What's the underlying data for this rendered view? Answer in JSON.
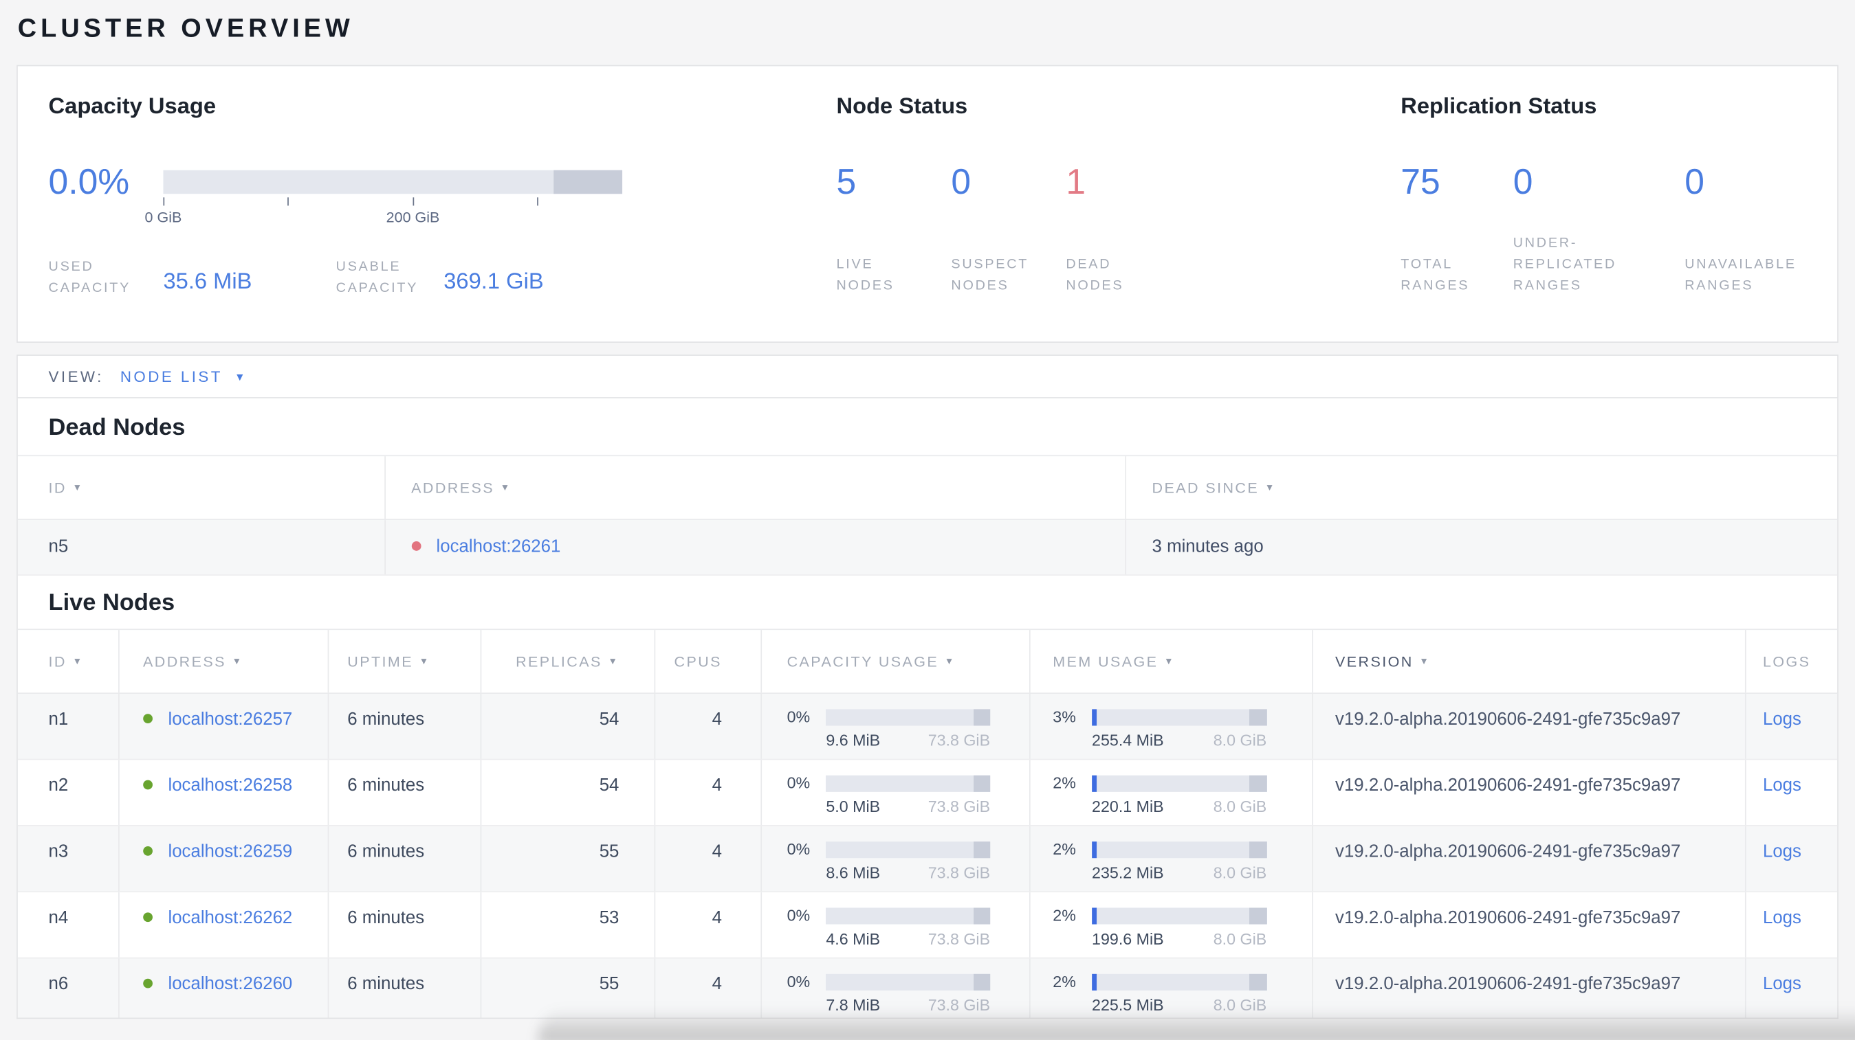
{
  "colors": {
    "accent_blue": "#4a7de0",
    "danger_red": "#e27a85",
    "live_dot": "#68a42f",
    "dead_dot": "#e2737f"
  },
  "page": {
    "title": "CLUSTER OVERVIEW"
  },
  "summary": {
    "capacity": {
      "title": "Capacity Usage",
      "percent": "0.0%",
      "tick_labels": [
        "0 GiB",
        "200 GiB"
      ],
      "metrics": [
        {
          "label": "USED\nCAPACITY",
          "value": "35.6 MiB"
        },
        {
          "label": "USABLE\nCAPACITY",
          "value": "369.1 GiB"
        }
      ]
    },
    "node_status": {
      "title": "Node Status",
      "stats": [
        {
          "value": "5",
          "label": "LIVE\nNODES"
        },
        {
          "value": "0",
          "label": "SUSPECT\nNODES"
        },
        {
          "value": "1",
          "label": "DEAD\nNODES"
        }
      ]
    },
    "replication_status": {
      "title": "Replication Status",
      "stats": [
        {
          "value": "75",
          "label": "TOTAL\nRANGES"
        },
        {
          "value": "0",
          "label": "UNDER-\nREPLICATED\nRANGES"
        },
        {
          "value": "0",
          "label": "UNAVAILABLE\nRANGES"
        }
      ]
    }
  },
  "view_bar": {
    "label": "VIEW:",
    "selected": "NODE LIST"
  },
  "dead_nodes": {
    "heading": "Dead Nodes",
    "columns": [
      "ID",
      "ADDRESS",
      "DEAD SINCE"
    ],
    "rows": [
      {
        "id": "n5",
        "address": "localhost:26261",
        "dead_since": "3 minutes ago"
      }
    ]
  },
  "live_nodes": {
    "heading": "Live Nodes",
    "columns": [
      "ID",
      "ADDRESS",
      "UPTIME",
      "REPLICAS",
      "CPUS",
      "CAPACITY USAGE",
      "MEM USAGE",
      "VERSION",
      "LOGS"
    ],
    "rows": [
      {
        "id": "n1",
        "address": "localhost:26257",
        "uptime": "6 minutes",
        "replicas": "54",
        "cpus": "4",
        "capacity_pct": "0%",
        "capacity_fill": 0,
        "capacity_used": "9.6 MiB",
        "capacity_total": "73.8 GiB",
        "mem_pct": "3%",
        "mem_fill": 3,
        "mem_used": "255.4 MiB",
        "mem_total": "8.0 GiB",
        "version": "v19.2.0-alpha.20190606-2491-gfe735c9a97",
        "logs": "Logs"
      },
      {
        "id": "n2",
        "address": "localhost:26258",
        "uptime": "6 minutes",
        "replicas": "54",
        "cpus": "4",
        "capacity_pct": "0%",
        "capacity_fill": 0,
        "capacity_used": "5.0 MiB",
        "capacity_total": "73.8 GiB",
        "mem_pct": "2%",
        "mem_fill": 2.5,
        "mem_used": "220.1 MiB",
        "mem_total": "8.0 GiB",
        "version": "v19.2.0-alpha.20190606-2491-gfe735c9a97",
        "logs": "Logs"
      },
      {
        "id": "n3",
        "address": "localhost:26259",
        "uptime": "6 minutes",
        "replicas": "55",
        "cpus": "4",
        "capacity_pct": "0%",
        "capacity_fill": 0,
        "capacity_used": "8.6 MiB",
        "capacity_total": "73.8 GiB",
        "mem_pct": "2%",
        "mem_fill": 2.5,
        "mem_used": "235.2 MiB",
        "mem_total": "8.0 GiB",
        "version": "v19.2.0-alpha.20190606-2491-gfe735c9a97",
        "logs": "Logs"
      },
      {
        "id": "n4",
        "address": "localhost:26262",
        "uptime": "6 minutes",
        "replicas": "53",
        "cpus": "4",
        "capacity_pct": "0%",
        "capacity_fill": 0,
        "capacity_used": "4.6 MiB",
        "capacity_total": "73.8 GiB",
        "mem_pct": "2%",
        "mem_fill": 2.5,
        "mem_used": "199.6 MiB",
        "mem_total": "8.0 GiB",
        "version": "v19.2.0-alpha.20190606-2491-gfe735c9a97",
        "logs": "Logs"
      },
      {
        "id": "n6",
        "address": "localhost:26260",
        "uptime": "6 minutes",
        "replicas": "55",
        "cpus": "4",
        "capacity_pct": "0%",
        "capacity_fill": 0,
        "capacity_used": "7.8 MiB",
        "capacity_total": "73.8 GiB",
        "mem_pct": "2%",
        "mem_fill": 2.5,
        "mem_used": "225.5 MiB",
        "mem_total": "8.0 GiB",
        "version": "v19.2.0-alpha.20190606-2491-gfe735c9a97",
        "logs": "Logs"
      }
    ]
  }
}
